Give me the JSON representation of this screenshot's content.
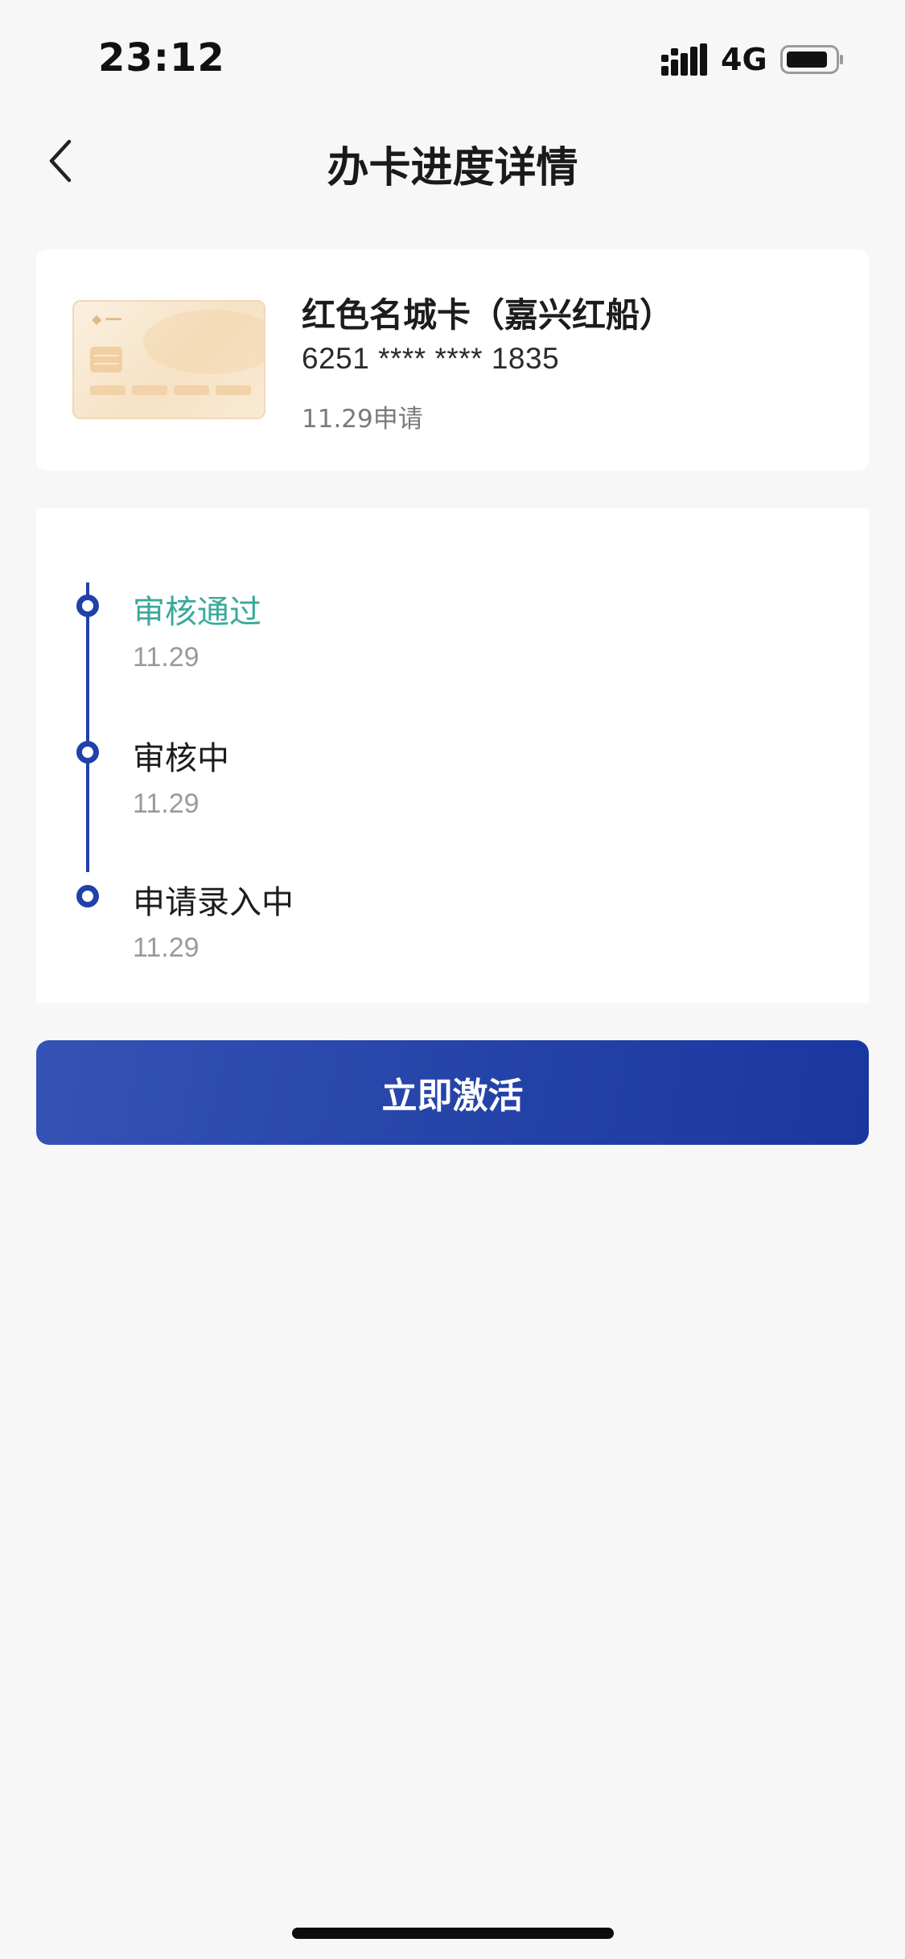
{
  "status_bar": {
    "time": "23:12",
    "network": "4G",
    "signal_icon": "signal-bars-icon",
    "battery_icon": "battery-icon"
  },
  "nav": {
    "title": "办卡进度详情",
    "back_icon": "chevron-left-icon"
  },
  "card": {
    "name": "红色名城卡（嘉兴红船）",
    "number": "6251 **** **** 1835",
    "applied": "11.29申请",
    "thumbnail_icon": "credit-card-image"
  },
  "timeline": {
    "steps": [
      {
        "label": "审核通过",
        "date": "11.29",
        "status": "done"
      },
      {
        "label": "审核中",
        "date": "11.29",
        "status": "normal"
      },
      {
        "label": "申请录入中",
        "date": "11.29",
        "status": "normal"
      }
    ],
    "accent_color": "#2140a8",
    "done_color": "#3aa99a"
  },
  "actions": {
    "activate_label": "立即激活",
    "button_color": "#2443a8"
  }
}
